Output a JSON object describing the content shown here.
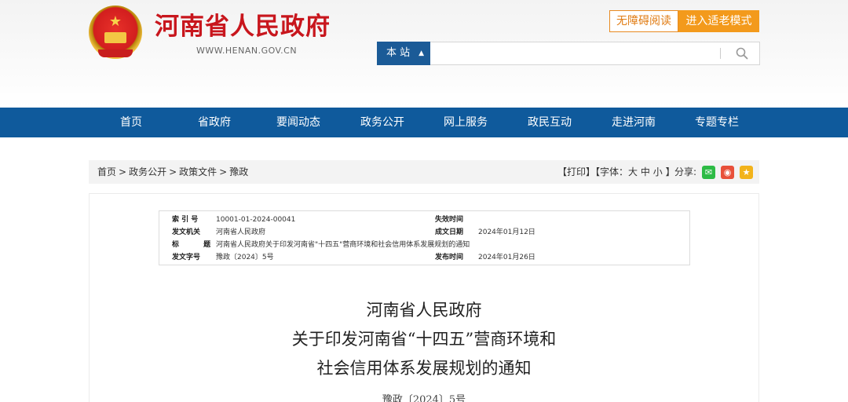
{
  "header": {
    "site_title": "河南省人民政府",
    "site_url": "WWW.HENAN.GOV.CN",
    "emblem_icon": "national-emblem-icon",
    "accessibility_label": "无障碍阅读",
    "elder_mode_label": "进入适老模式",
    "search": {
      "scope_label": "本 站",
      "query": "",
      "placeholder": ""
    }
  },
  "nav": {
    "items": [
      "首页",
      "省政府",
      "要闻动态",
      "政务公开",
      "网上服务",
      "政民互动",
      "走进河南",
      "专题专栏"
    ]
  },
  "breadcrumb": {
    "items": [
      "首页",
      "政务公开",
      "政策文件",
      "豫政"
    ],
    "separator": ">"
  },
  "tools": {
    "print_label": "【打印】",
    "font_size_prefix": "【字体：",
    "font_large": "大",
    "font_medium": "中",
    "font_small": "小",
    "font_size_suffix": "】",
    "share_label": "分享:"
  },
  "share_icons": [
    {
      "name": "wechat-icon",
      "color": "#2dbb45",
      "glyph": "✉"
    },
    {
      "name": "weibo-icon",
      "color": "#e8503a",
      "glyph": "◉"
    },
    {
      "name": "favorite-star-icon",
      "color": "#f2b31b",
      "glyph": "★"
    }
  ],
  "metadata": {
    "index_label": "索 引 号",
    "index_value": "10001-01-2024-00041",
    "expiry_label": "失效时间",
    "expiry_value": "",
    "issuer_label": "发文机关",
    "issuer_value": "河南省人民政府",
    "written_date_label": "成文日期",
    "written_date_value": "2024年01月12日",
    "title_label": "标 题",
    "title_value": "河南省人民政府关于印发河南省\"十四五\"营商环境和社会信用体系发展规划的通知",
    "doc_no_label": "发文字号",
    "doc_no_value": "豫政〔2024〕5号",
    "publish_date_label": "发布时间",
    "publish_date_value": "2024年01月26日"
  },
  "document": {
    "title_line1": "河南省人民政府",
    "title_line2": "关于印发河南省“十四五”营商环境和",
    "title_line3": "社会信用体系发展规划的通知",
    "doc_number": "豫政〔2024〕5号"
  },
  "colors": {
    "brand_red": "#c8161d",
    "nav_blue": "#0f5a9c",
    "accent_orange": "#f39a1c"
  }
}
